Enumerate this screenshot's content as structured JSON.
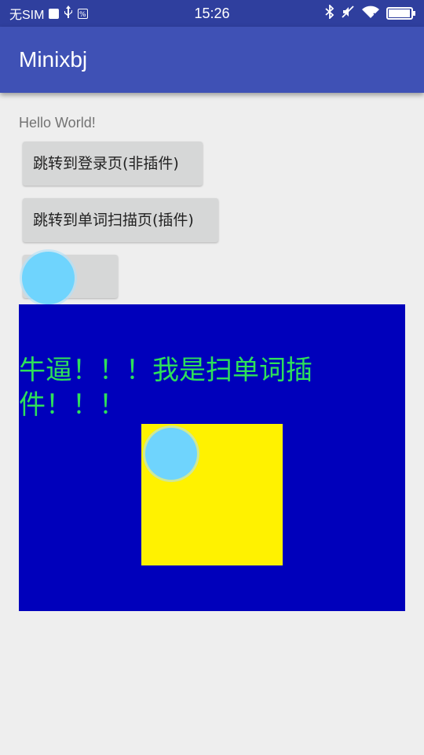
{
  "status_bar": {
    "carrier": "无SIM",
    "time": "15:26",
    "battery_level": 0.95,
    "icons": [
      "check-box-icon",
      "usb-icon",
      "notification-icon",
      "bluetooth-icon",
      "mute-icon",
      "wifi-icon",
      "battery-icon"
    ]
  },
  "app_bar": {
    "title": "Minixbj"
  },
  "content": {
    "hello_text": "Hello World!",
    "login_button": "跳转到登录页(非插件)",
    "scan_button": "跳转到单词扫描页(插件)",
    "toggle_button": ""
  },
  "plugin_panel": {
    "message": "牛逼！！！我是扫单词插件！！！"
  },
  "colors": {
    "status_bar": "#2f3f9e",
    "app_bar": "#3f51b5",
    "background": "#eeeeee",
    "button": "#d6d7d7",
    "panel": "#0000bb",
    "panel_text": "#2ee05a",
    "yellow_box": "#fff200",
    "float_ball": "#6fd4fd"
  }
}
